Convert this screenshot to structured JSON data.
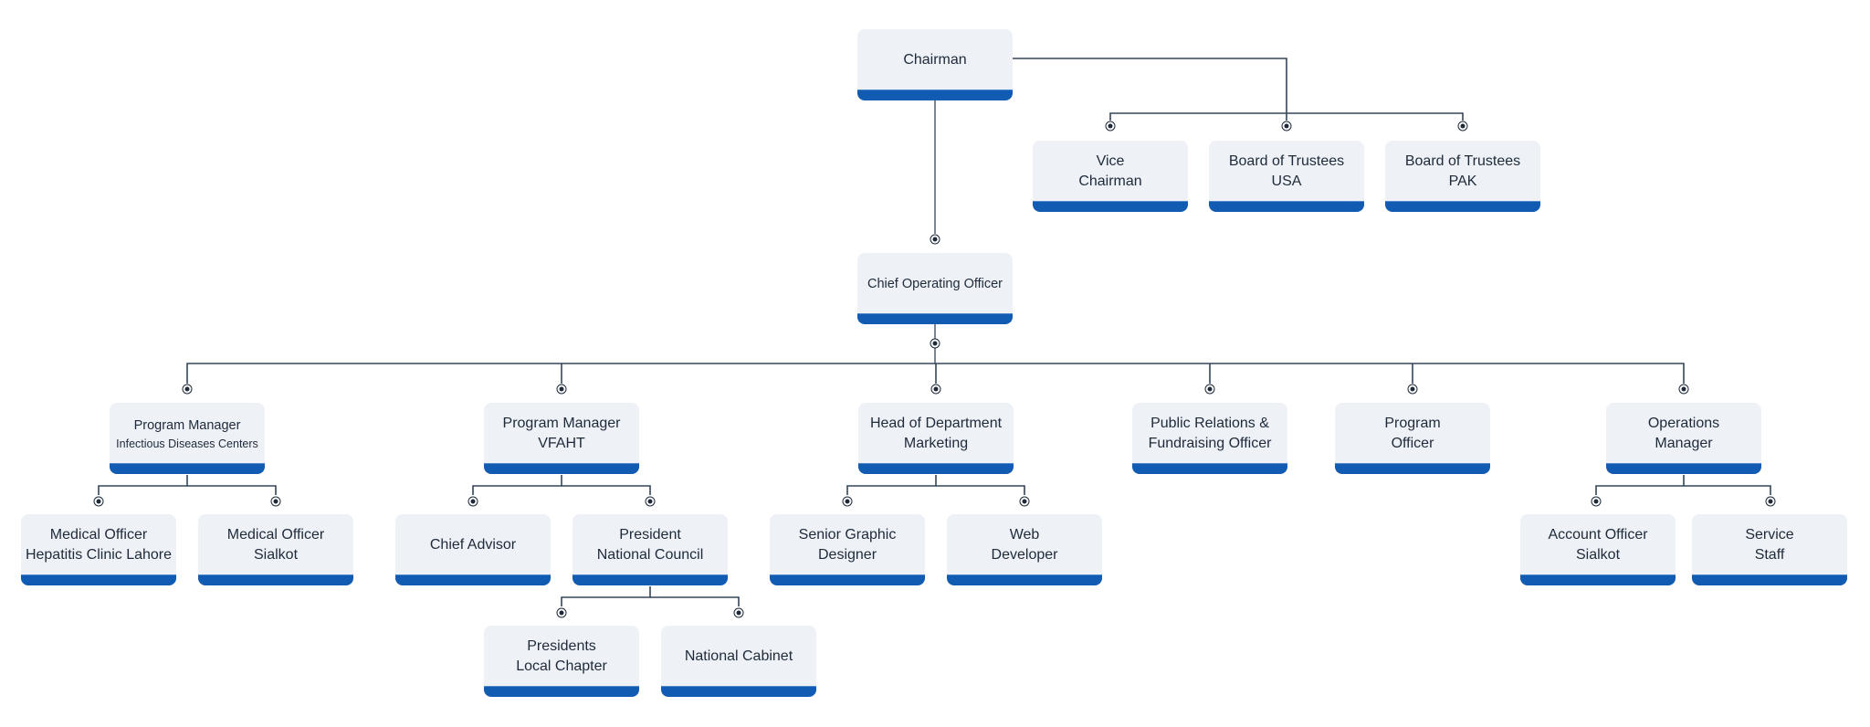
{
  "chart_title": "",
  "nodes": {
    "chairman": {
      "line1": "Chairman",
      "line2": ""
    },
    "vice_chairman": {
      "line1": "Vice",
      "line2": "Chairman"
    },
    "trustees_usa": {
      "line1": "Board of Trustees",
      "line2": "USA"
    },
    "trustees_pak": {
      "line1": "Board of Trustees",
      "line2": "PAK"
    },
    "coo": {
      "line1": "Chief Operating Officer",
      "line2": ""
    },
    "pm_idc": {
      "line1": "Program Manager",
      "line2": "Infectious Diseases Centers"
    },
    "pm_vfaht": {
      "line1": "Program Manager",
      "line2": "VFAHT"
    },
    "hod_marketing": {
      "line1": "Head of Department",
      "line2": "Marketing"
    },
    "pr_officer": {
      "line1": "Public Relations &",
      "line2": "Fundraising Officer"
    },
    "program_officer": {
      "line1": "Program",
      "line2": "Officer"
    },
    "ops_manager": {
      "line1": "Operations",
      "line2": "Manager"
    },
    "mo_lahore": {
      "line1": "Medical Officer",
      "line2": "Hepatitis Clinic Lahore"
    },
    "mo_sialkot": {
      "line1": "Medical Officer",
      "line2": "Sialkot"
    },
    "chief_advisor": {
      "line1": "Chief Advisor",
      "line2": ""
    },
    "president_nc": {
      "line1": "President",
      "line2": "National Council"
    },
    "presidents_lc": {
      "line1": "Presidents",
      "line2": "Local Chapter"
    },
    "national_cabinet": {
      "line1": "National Cabinet",
      "line2": ""
    },
    "senior_designer": {
      "line1": "Senior Graphic",
      "line2": "Designer"
    },
    "web_developer": {
      "line1": "Web",
      "line2": "Developer"
    },
    "account_officer": {
      "line1": "Account Officer",
      "line2": "Sialkot"
    },
    "service_staff": {
      "line1": "Service",
      "line2": "Staff"
    }
  },
  "colors": {
    "card": "#eef1f6",
    "accent": "#125bb3",
    "text": "#1e2a3a",
    "line": "#34465a"
  }
}
